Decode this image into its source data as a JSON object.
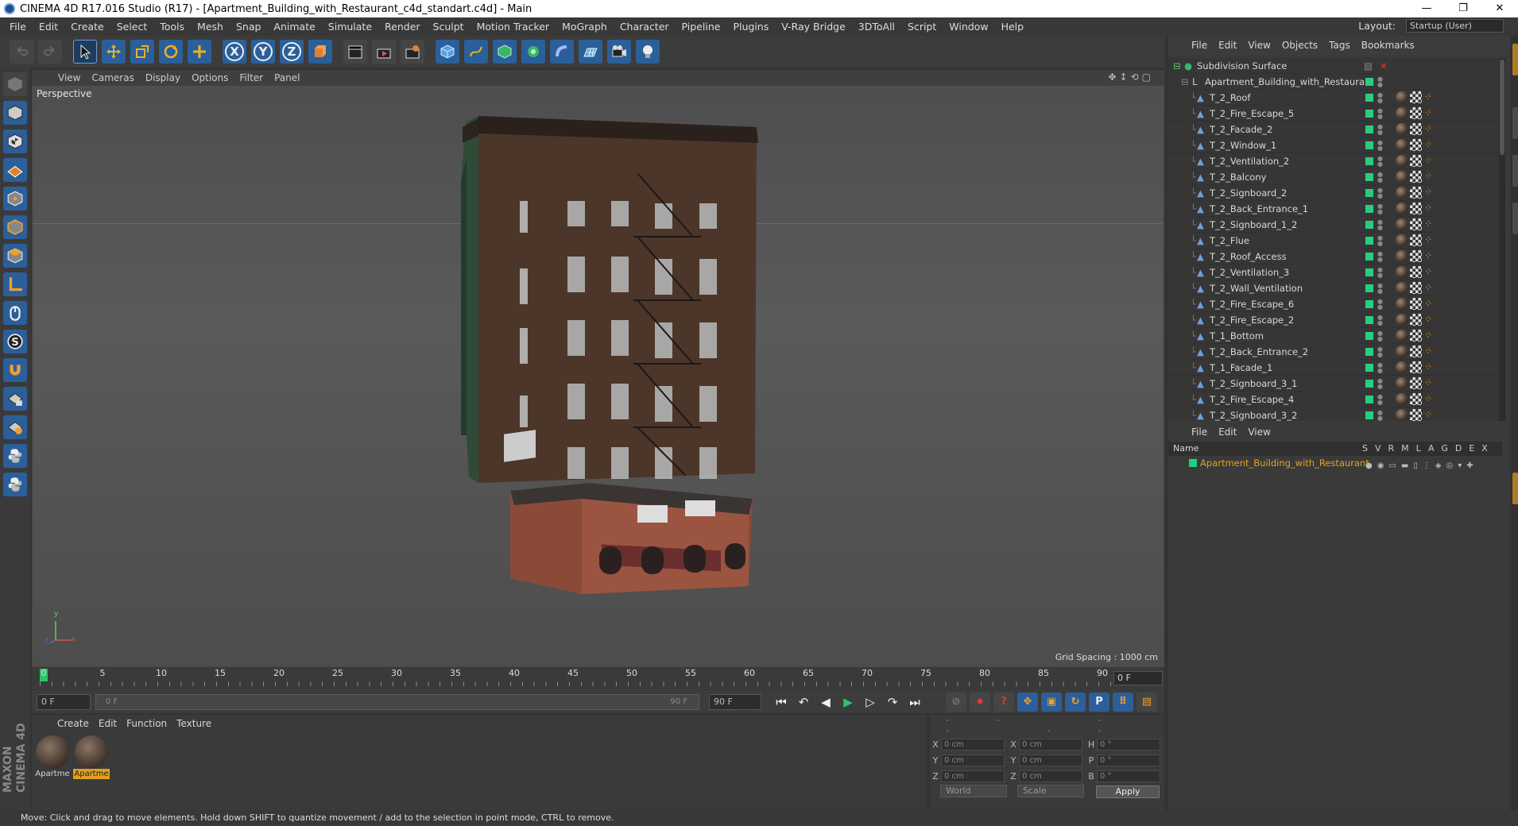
{
  "window": {
    "title": "CINEMA 4D R17.016 Studio (R17) - [Apartment_Building_with_Restaurant_c4d_standart.c4d] - Main",
    "minimize": "—",
    "restore": "❐",
    "close": "✕"
  },
  "menubar": {
    "items": [
      "File",
      "Edit",
      "Create",
      "Select",
      "Tools",
      "Mesh",
      "Snap",
      "Animate",
      "Simulate",
      "Render",
      "Sculpt",
      "Motion Tracker",
      "MoGraph",
      "Character",
      "Pipeline",
      "Plugins",
      "V-Ray Bridge",
      "3DToAll",
      "Script",
      "Window",
      "Help"
    ],
    "layout_label": "Layout:",
    "layout_value": "Startup (User)"
  },
  "toolbar": {
    "x_axis": "X",
    "y_axis": "Y",
    "z_axis": "Z"
  },
  "viewport": {
    "menu": [
      "View",
      "Cameras",
      "Display",
      "Options",
      "Filter",
      "Panel"
    ],
    "label": "Perspective",
    "grid_spacing": "Grid Spacing : 1000 cm",
    "axis_y": "y",
    "axis_x": "x",
    "axis_z": "z"
  },
  "timeline": {
    "ticks": [
      "0",
      "5",
      "10",
      "15",
      "20",
      "25",
      "30",
      "35",
      "40",
      "45",
      "50",
      "55",
      "60",
      "65",
      "70",
      "75",
      "80",
      "85",
      "90"
    ],
    "current_frame": "0 F",
    "start_field": "0 F",
    "range_start": "0 F",
    "range_end": "90 F",
    "end_field": "90 F"
  },
  "material_manager": {
    "menu": [
      "Create",
      "Edit",
      "Function",
      "Texture"
    ],
    "materials": [
      {
        "label": "Apartme",
        "highlighted": false
      },
      {
        "label": "Apartme",
        "highlighted": true
      }
    ]
  },
  "coordinates": {
    "header": "-- -- --",
    "rows": [
      {
        "a": "X",
        "av": "0 cm",
        "b": "X",
        "bv": "0 cm",
        "c": "H",
        "cv": "0 °"
      },
      {
        "a": "Y",
        "av": "0 cm",
        "b": "Y",
        "bv": "0 cm",
        "c": "P",
        "cv": "0 °"
      },
      {
        "a": "Z",
        "av": "0 cm",
        "b": "Z",
        "bv": "0 cm",
        "c": "B",
        "cv": "0 °"
      }
    ],
    "mode": "World",
    "transform": "Scale",
    "apply": "Apply"
  },
  "object_manager": {
    "menu": [
      "File",
      "Edit",
      "View",
      "Objects",
      "Tags",
      "Bookmarks"
    ],
    "root": "Subdivision Surface",
    "group": "Apartment_Building_with_Restaurant",
    "objects": [
      "T_2_Roof",
      "T_2_Fire_Escape_5",
      "T_2_Facade_2",
      "T_2_Window_1",
      "T_2_Ventilation_2",
      "T_2_Balcony",
      "T_2_Signboard_2",
      "T_2_Back_Entrance_1",
      "T_2_Signboard_1_2",
      "T_2_Flue",
      "T_2_Roof_Access",
      "T_2_Ventilation_3",
      "T_2_Wall_Ventilation",
      "T_2_Fire_Escape_6",
      "T_2_Fire_Escape_2",
      "T_1_Bottom",
      "T_2_Back_Entrance_2",
      "T_1_Facade_1",
      "T_2_Signboard_3_1",
      "T_2_Fire_Escape_4",
      "T_2_Signboard_3_2"
    ]
  },
  "attribute_manager": {
    "menu": [
      "File",
      "Edit",
      "View"
    ],
    "name_header": "Name",
    "columns": "SVRMLAGDEX",
    "row_name": "Apartment_Building_with_Restaurant"
  },
  "statusbar": {
    "text": "Move: Click and drag to move elements. Hold down SHIFT to quantize movement / add to the selection in point mode, CTRL to remove."
  },
  "colors": {
    "accent_green": "#24d080",
    "highlight_orange": "#e0a020",
    "tool_blue": "#2b5f9a"
  }
}
